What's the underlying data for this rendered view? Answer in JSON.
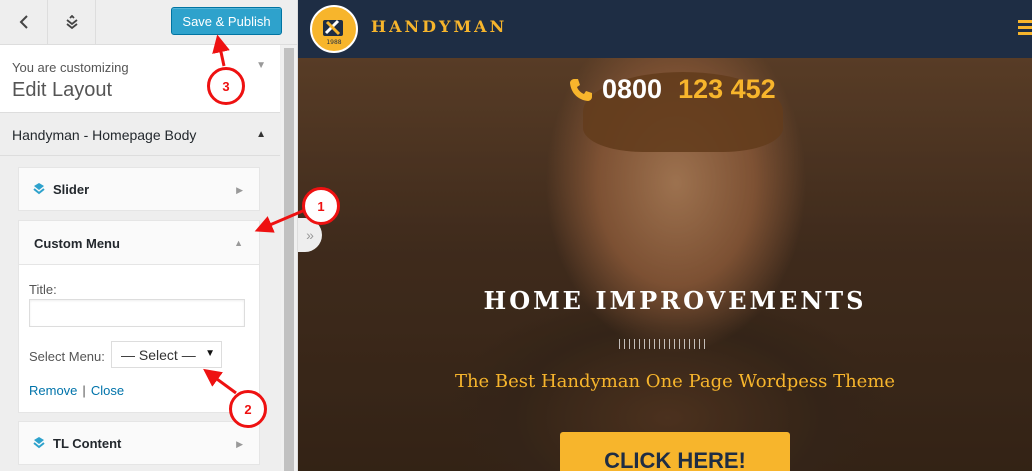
{
  "customizer": {
    "publish_label": "Save & Publish",
    "info": {
      "small": "You are customizing",
      "big": "Edit Layout"
    },
    "section_title": "Handyman - Homepage Body",
    "widgets": {
      "slider": {
        "title": "Slider"
      },
      "menu": {
        "title": "Custom Menu",
        "title_label": "Title:",
        "title_value": "",
        "select_label": "Select Menu:",
        "select_value": "— Select —",
        "remove_link": "Remove",
        "close_link": "Close",
        "separator": "|"
      },
      "tl": {
        "title": "TL Content"
      }
    }
  },
  "preview": {
    "brand": "HANDYMAN",
    "logo_year": "1988",
    "phone_part1": "0800",
    "phone_part2": "123 452",
    "headline": "HOME IMPROVEMENTS",
    "subtitle": "The Best Handyman One Page Wordpess Theme",
    "cta": "CLICK HERE!"
  },
  "annotations": {
    "badge1": "1",
    "badge2": "2",
    "badge3": "3"
  },
  "colors": {
    "accent": "#f7b52c",
    "header": "#1e2d44",
    "publish": "#2ea2cc",
    "annotation": "#ee1111"
  }
}
